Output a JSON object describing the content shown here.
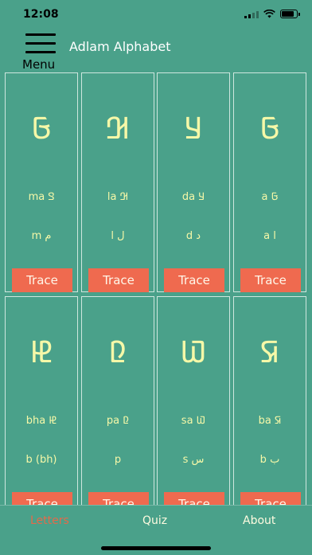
{
  "status": {
    "time": "12:08",
    "battery_level": 0.9
  },
  "header": {
    "menu_label": "Menu",
    "title": "Adlam Alphabet"
  },
  "trace_label": "Trace",
  "cards": [
    {
      "glyph": "𞤀",
      "line1": "ma 𞤃",
      "line2": "m م"
    },
    {
      "glyph": "𞤂",
      "line1": "la 𞤂",
      "line2": "l ل"
    },
    {
      "glyph": "𞤁",
      "line1": "da 𞤁",
      "line2": "d د"
    },
    {
      "glyph": "𞤀",
      "line1": "a 𞤀",
      "line2": "a ا"
    },
    {
      "glyph": "𞤄",
      "line1": "bha 𞤄",
      "line2": "b (bh)"
    },
    {
      "glyph": "𞤆",
      "line1": "pa 𞤆",
      "line2": "p"
    },
    {
      "glyph": "𞤅",
      "line1": "sa 𞤅",
      "line2": "s س"
    },
    {
      "glyph": "𞤇",
      "line1": "ba 𞤇",
      "line2": "b ب"
    }
  ],
  "tabs": [
    {
      "label": "Letters",
      "active": true
    },
    {
      "label": "Quiz",
      "active": false
    },
    {
      "label": "About",
      "active": false
    }
  ]
}
